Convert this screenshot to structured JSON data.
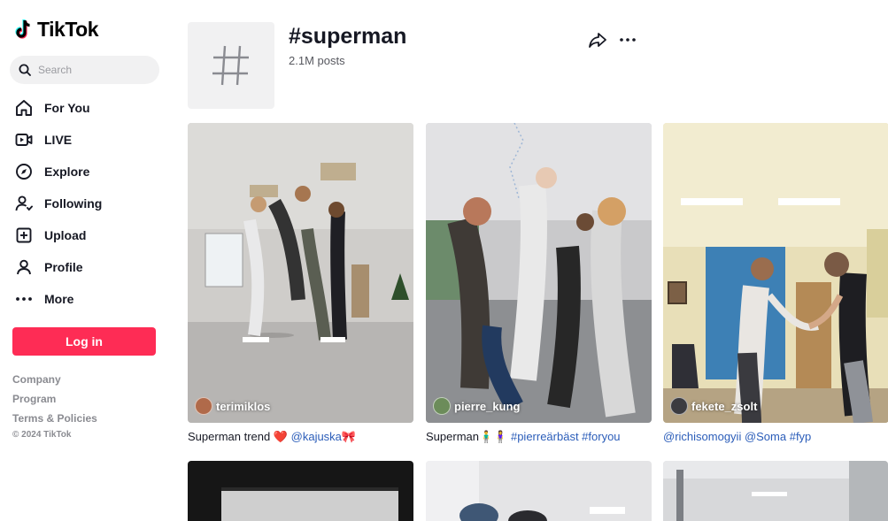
{
  "app": {
    "name": "TikTok"
  },
  "colors": {
    "accent": "#fe2c55",
    "tag_link": "#2b5db9",
    "muted": "#8a8b91"
  },
  "search": {
    "placeholder": "Search"
  },
  "nav": [
    {
      "label": "For You",
      "icon": "home-icon"
    },
    {
      "label": "LIVE",
      "icon": "live-icon"
    },
    {
      "label": "Explore",
      "icon": "compass-icon"
    },
    {
      "label": "Following",
      "icon": "following-icon"
    },
    {
      "label": "Upload",
      "icon": "upload-icon"
    },
    {
      "label": "Profile",
      "icon": "profile-icon"
    },
    {
      "label": "More",
      "icon": "more-dots-icon"
    }
  ],
  "login": {
    "label": "Log in"
  },
  "footer": {
    "links": [
      "Company",
      "Program",
      "Terms & Policies"
    ],
    "copyright": "© 2024 TikTok"
  },
  "hashtag": {
    "title": "#superman",
    "posts": "2.1M posts"
  },
  "videos": [
    {
      "author": "terimiklos",
      "caption_text": "Superman trend ❤️ ",
      "caption_tags": "@kajuska🎀"
    },
    {
      "author": "pierre_kung",
      "caption_text": "Superman🧍‍♂️🧍‍♀️ ",
      "caption_tags": "#pierreärbäst #foryou"
    },
    {
      "author": "fekete_zsolt",
      "caption_text": "",
      "caption_tags": "@richisomogyii @Soma #fyp"
    }
  ]
}
